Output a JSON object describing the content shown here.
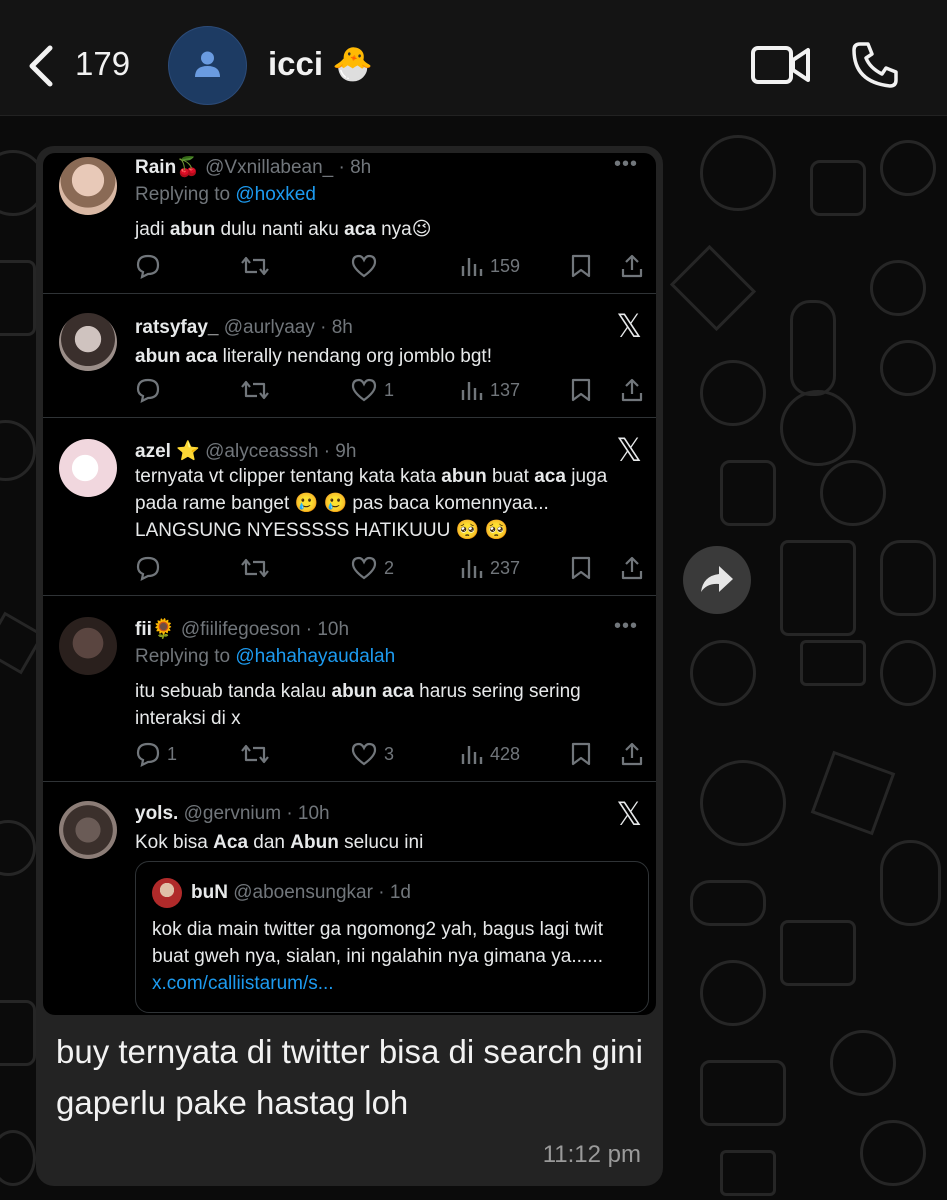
{
  "header": {
    "unread_count": "179",
    "contact_name": "icci",
    "contact_emoji": "🐣"
  },
  "tweets": [
    {
      "name": "Rain🍒",
      "handle": "@Vxnillabean_",
      "time": "· 8h",
      "replying_prefix": "Replying to ",
      "replying_to": "@hoxked",
      "text_parts": [
        "jadi ",
        "abun",
        " dulu nanti aku ",
        "aca",
        " nya😉"
      ],
      "replies": "",
      "likes": "",
      "views": "159",
      "corner": "more"
    },
    {
      "name": "ratsyfay_",
      "handle": "@aurlyaay",
      "time": "· 8h",
      "text_parts": [
        "abun aca",
        " literally nendang org jomblo bgt!"
      ],
      "replies": "",
      "likes": "1",
      "views": "137",
      "corner": "x"
    },
    {
      "name": "azel ⭐",
      "handle": "@alyceasssh",
      "time": "· 9h",
      "text_parts": [
        "ternyata vt clipper tentang kata kata ",
        "abun",
        " buat ",
        "aca",
        " juga pada rame banget 🥲 🥲  pas baca komennyaa... LANGSUNG NYESSSSS HATIKUUU 🥺 🥺"
      ],
      "replies": "",
      "likes": "2",
      "views": "237",
      "corner": "x"
    },
    {
      "name": "fii🌻",
      "handle": "@fiilifegoeson",
      "time": "· 10h",
      "replying_prefix": "Replying to ",
      "replying_to": "@hahahayaudalah",
      "text_parts": [
        "itu sebuab tanda kalau ",
        "abun aca",
        " harus sering sering interaksi di x"
      ],
      "replies": "1",
      "likes": "3",
      "views": "428",
      "corner": "more"
    },
    {
      "name": "yols.",
      "handle": "@gervnium",
      "time": "· 10h",
      "text_parts": [
        "Kok bisa ",
        "Aca",
        " dan ",
        "Abun",
        " selucu ini"
      ],
      "corner": "x"
    }
  ],
  "quote": {
    "name": "buN",
    "handle": "@aboensungkar",
    "time": "· 1d",
    "text": "kok dia main twitter ga ngomong2 yah, bagus lagi twit buat gweh nya, sialan, ini ngalahin nya gimana ya......",
    "link": "x.com/calliistarum/s..."
  },
  "message": {
    "caption": "buy ternyata di twitter bisa di search gini gaperlu pake hastag loh",
    "time": "11:12 pm"
  },
  "icons": {
    "more": "•••",
    "x_logo": "𝕏"
  },
  "colors": {
    "link": "#1d9bf0",
    "muted": "#71767b",
    "bubble": "#232323"
  }
}
